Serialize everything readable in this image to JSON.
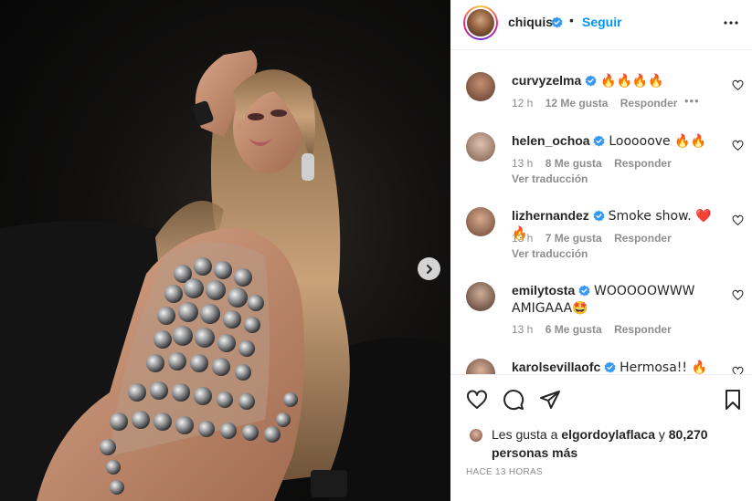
{
  "post": {
    "author": "chiquis",
    "follow_label": "Seguir",
    "separator": "•",
    "time_ago": "HACE 13 HORAS"
  },
  "likes": {
    "prefix": "Les gusta a",
    "first_user": "elgordoylaflaca",
    "connector": "y",
    "count_text": "80,270 personas más"
  },
  "colors": {
    "accent": "#0095f6",
    "verified": "#3897f0",
    "text": "#262626",
    "muted": "#8e8e8e"
  },
  "icons": {
    "more": "more-options-icon",
    "like": "heart-outline-icon",
    "comment": "comment-bubble-icon",
    "share": "paper-plane-icon",
    "save": "bookmark-icon",
    "next": "chevron-right-icon"
  },
  "comments": [
    {
      "user": "curvyzelma",
      "text": "🔥🔥🔥🔥",
      "time": "12 h",
      "likes": "12 Me gusta",
      "reply": "Responder",
      "translate": "",
      "show_more_dots": true
    },
    {
      "user": "helen_ochoa",
      "text": "Looooove 🔥🔥",
      "time": "13 h",
      "likes": "8 Me gusta",
      "reply": "Responder",
      "translate": "Ver traducción"
    },
    {
      "user": "lizhernandez",
      "text": "Smoke show. ❤️🔥",
      "time": "13 h",
      "likes": "7 Me gusta",
      "reply": "Responder",
      "translate": "Ver traducción"
    },
    {
      "user": "emilytosta",
      "text": "WOOOOOWWW AMIGAAA🤩",
      "time": "13 h",
      "likes": "6 Me gusta",
      "reply": "Responder",
      "translate": ""
    },
    {
      "user": "karolsevillaofc",
      "text": "Hermosa!! 🔥🔥",
      "time": "",
      "likes": "",
      "reply": "",
      "translate": ""
    }
  ]
}
